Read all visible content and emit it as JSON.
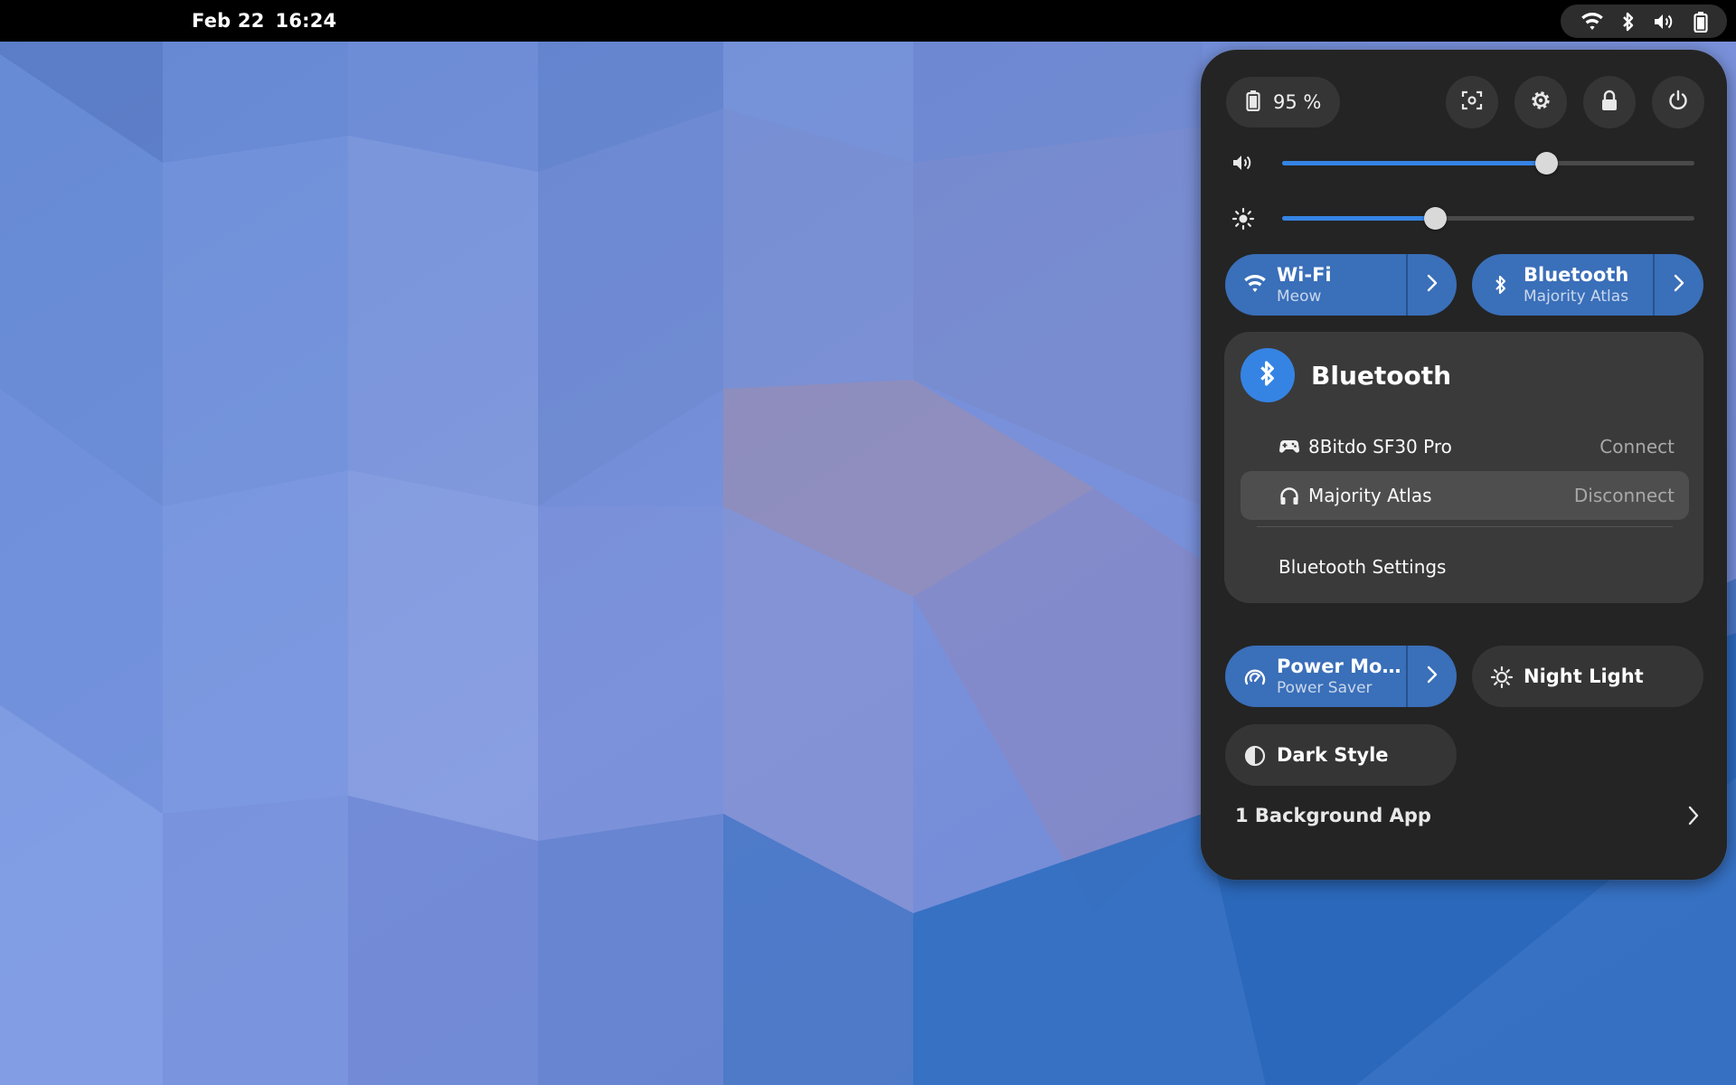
{
  "topbar": {
    "date": "Feb 22",
    "time": "16:24",
    "tray_icons": [
      "wifi-icon",
      "bluetooth-icon",
      "volume-icon",
      "battery-icon"
    ]
  },
  "quick_settings": {
    "battery": {
      "icon": "battery-icon",
      "label": "95 %"
    },
    "buttons": [
      "screenshot-icon",
      "settings-icon",
      "lock-icon",
      "power-icon"
    ],
    "volume": {
      "icon": "volume-icon",
      "level": 0.64
    },
    "brightness": {
      "icon": "brightness-icon",
      "level": 0.37
    },
    "wifi": {
      "title": "Wi-Fi",
      "subtitle": "Meow",
      "enabled": true
    },
    "bluetooth": {
      "title": "Bluetooth",
      "subtitle": "Majority Atlas",
      "enabled": true
    },
    "bluetooth_menu": {
      "title": "Bluetooth",
      "devices": [
        {
          "icon": "gamepad-icon",
          "name": "8Bitdo SF30 Pro",
          "action": "Connect"
        },
        {
          "icon": "headphones-icon",
          "name": "Majority Atlas",
          "action": "Disconnect"
        }
      ],
      "settings_label": "Bluetooth Settings"
    },
    "power_mode": {
      "title": "Power Mo…",
      "subtitle": "Power Saver",
      "enabled": true
    },
    "night_light": {
      "title": "Night Light",
      "enabled": false
    },
    "dark_style": {
      "title": "Dark Style",
      "enabled": false
    },
    "background_apps": {
      "label": "1 Background App"
    }
  },
  "colors": {
    "accent": "#3584e4",
    "toggle_on": "#3a6fb9",
    "panel_bg": "#242424",
    "button_bg": "#353535"
  }
}
